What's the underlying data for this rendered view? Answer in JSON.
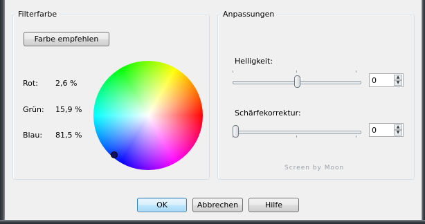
{
  "filter_group": {
    "title": "Filterfarbe",
    "suggest_button": "Farbe empfehlen",
    "rows": [
      {
        "label": "Rot:",
        "value": "2,6 %"
      },
      {
        "label": "Grün:",
        "value": "15,9 %"
      },
      {
        "label": "Blau:",
        "value": "81,5 %"
      }
    ],
    "wheel_marker_color": "#101060"
  },
  "adjust_group": {
    "title": "Anpassungen",
    "brightness": {
      "label": "Helligkeit:",
      "value": "0",
      "slider_fraction": 0.5
    },
    "sharpness": {
      "label": "Schärfekorrektur:",
      "value": "0",
      "slider_fraction": 0.0
    },
    "watermark": "Screen by Moon"
  },
  "buttons": {
    "ok": "OK",
    "cancel": "Abbrechen",
    "help": "Hilfe"
  },
  "colors": {
    "default_button_border": "#3c7fb1",
    "group_border": "#d5dfe5"
  }
}
